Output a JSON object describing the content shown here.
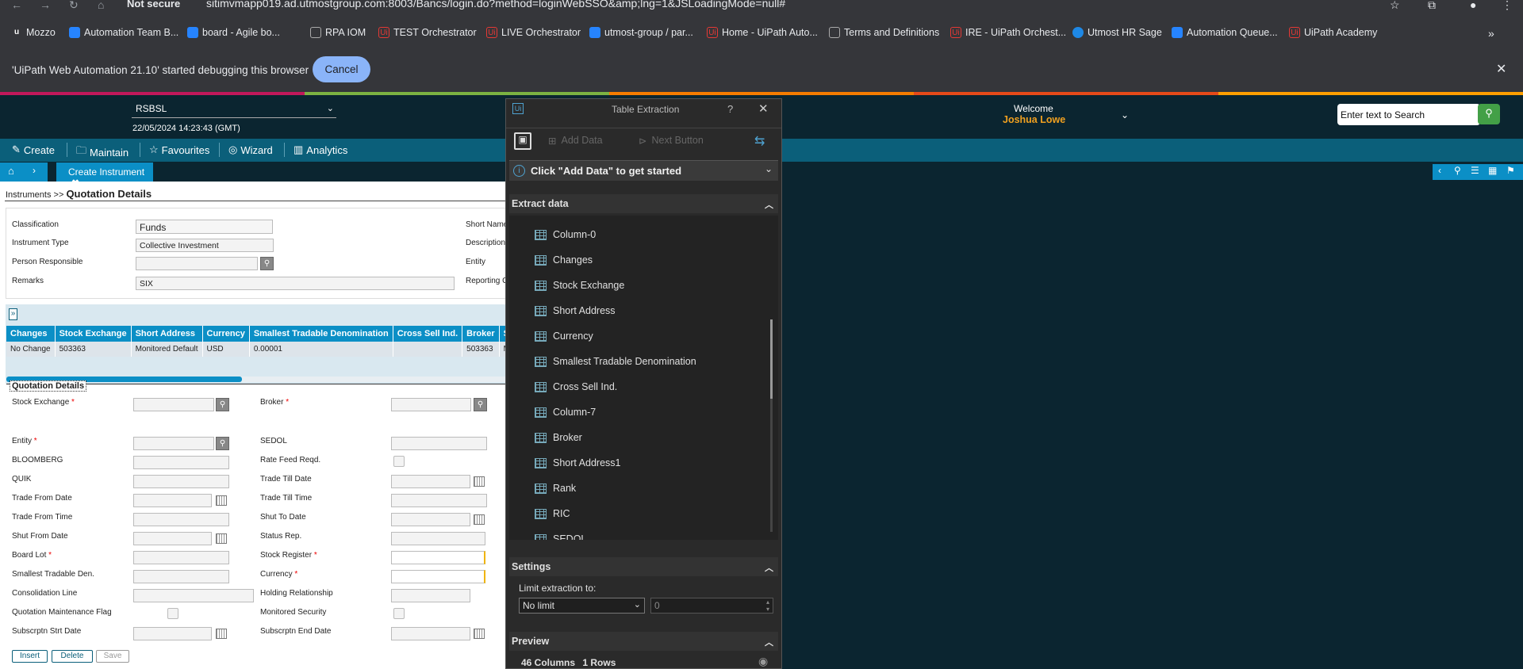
{
  "browser": {
    "not_secure": "Not secure",
    "url": "sitimvmapp019.ad.utmostgroup.com:8003/Bancs/login.do?method=loginWebSSO&amp;lng=1&JSLoadingMode=null#",
    "bookmarks": [
      "Mozzo",
      "Automation Team B...",
      "board - Agile bo...",
      "RPA IOM",
      "TEST Orchestrator",
      "LIVE Orchestrator",
      "utmost-group / par...",
      "Home - UiPath Auto...",
      "Terms and Definitions",
      "IRE - UiPath Orchest...",
      "Utmost HR Sage",
      "Automation Queue...",
      "UiPath Academy"
    ],
    "infobar_text": "'UiPath Web Automation 21.10' started debugging this browser",
    "cancel": "Cancel"
  },
  "app": {
    "company": "RSBSL",
    "datetime": "22/05/2024 14:23:43 (GMT)",
    "welcome": "Welcome",
    "user": "Joshua Lowe",
    "search_placeholder": "Enter text to Search",
    "nav": [
      "Create",
      "Maintain",
      "Favourites",
      "Wizard",
      "Analytics"
    ],
    "tab": "Create Instrument",
    "breadcrumb_root": "Instruments >>",
    "breadcrumb_page": "Quotation Details"
  },
  "instrument": {
    "classification_label": "Classification",
    "classification": "Funds",
    "type_label": "Instrument Type",
    "type": "Collective Investment",
    "person_label": "Person Responsible",
    "remarks_label": "Remarks",
    "remarks": "SIX",
    "short_name_label": "Short Name",
    "description_label": "Description",
    "entity_label": "Entity",
    "reporting_label": "Reporting C"
  },
  "grid": {
    "expand": "»",
    "headers": [
      "Changes",
      "Stock Exchange",
      "Short Address",
      "Currency",
      "Smallest Tradable Denomination",
      "Cross Sell Ind.",
      "Broker",
      "Short"
    ],
    "row": [
      "No Change",
      "503363",
      "Monitored Default",
      "USD",
      "0.00001",
      "",
      "503363",
      "Monit"
    ]
  },
  "quotation": {
    "title": "Quotation Details",
    "left": [
      "Stock Exchange",
      "Entity",
      "BLOOMBERG",
      "QUIK",
      "Trade From Date",
      "Trade From Time",
      "Shut From Date",
      "Board Lot",
      "Smallest Tradable Den.",
      "Consolidation Line",
      "Quotation Maintenance Flag",
      "Subscrptn Strt Date"
    ],
    "right": [
      "Broker",
      "SEDOL",
      "Rate Feed Reqd.",
      "Trade Till Date",
      "Trade Till Time",
      "Shut To Date",
      "Status Rep.",
      "Stock Register",
      "Currency",
      "Holding Relationship",
      "Monitored Security",
      "Subscrptn End Date"
    ],
    "buttons": [
      "Insert",
      "Delete",
      "Save"
    ]
  },
  "extraction": {
    "title": "Table Extraction",
    "help": "?",
    "add_data": "Add Data",
    "next_button": "Next Button",
    "hint": "Click \"Add Data\" to get started",
    "extract_title": "Extract data",
    "columns": [
      "Column-0",
      "Changes",
      "Stock Exchange",
      "Short Address",
      "Currency",
      "Smallest Tradable Denomination",
      "Cross Sell Ind.",
      "Column-7",
      "Broker",
      "Short Address1",
      "Rank",
      "RIC",
      "SEDOL"
    ],
    "settings_title": "Settings",
    "limit_label": "Limit extraction to:",
    "limit_value": "No limit",
    "limit_number": "0",
    "preview_title": "Preview",
    "preview_columns": "46 Columns",
    "preview_rows": "1 Rows"
  }
}
